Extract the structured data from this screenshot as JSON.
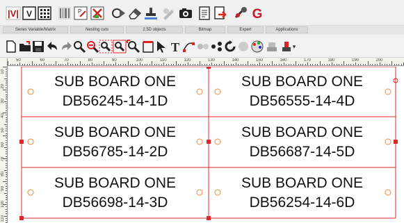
{
  "ribbon": {
    "icons": [
      {
        "name": "series-variable-icon",
        "glyph": "|V|"
      },
      {
        "name": "variable-icon",
        "glyph": "V"
      },
      {
        "name": "matrix-icon",
        "glyph": "grid"
      },
      {
        "name": "barcode-icon",
        "glyph": "bars"
      },
      {
        "name": "nesting-icon",
        "glyph": "nest"
      },
      {
        "name": "nesting-cuts-icon",
        "glyph": "cuts"
      },
      {
        "name": "shapes-icon",
        "glyph": "shapes"
      },
      {
        "name": "eraser-icon",
        "glyph": "eraser"
      },
      {
        "name": "stamp-icon",
        "glyph": "stamp"
      },
      {
        "name": "bitmap-pen-icon",
        "glyph": "pen"
      },
      {
        "name": "camera-icon",
        "glyph": "camera"
      },
      {
        "name": "document-icon",
        "glyph": "doc"
      },
      {
        "name": "export-icon",
        "glyph": "export"
      },
      {
        "name": "tools-icon",
        "glyph": "tools"
      },
      {
        "name": "app-logo-icon",
        "glyph": "G"
      }
    ],
    "groups": [
      {
        "name": "group-series-variable-matrix",
        "label": "Series Variable/Matrix"
      },
      {
        "name": "group-nesting-cuts",
        "label": "Nesting cuts"
      },
      {
        "name": "group-2-5d-objects",
        "label": "2.5D objects"
      },
      {
        "name": "group-bitmap",
        "label": "Bitmap"
      },
      {
        "name": "group-expert",
        "label": "Expert"
      },
      {
        "name": "group-applications",
        "label": "Applications"
      }
    ]
  },
  "toolbar": {
    "icons": [
      "new-document-icon",
      "open-folder-icon",
      "save-icon",
      "undo-icon",
      "redo-icon",
      "zoom-in-icon",
      "zoom-out-icon",
      "zoom-window-icon",
      "zoom-all-icon",
      "zoom-fit-icon",
      "page-frame-icon",
      "select-arrow-icon",
      "text-tool-icon",
      "node-edit-icon",
      "distribute-icon",
      "connect-icon",
      "rotate-icon",
      "color-icon",
      "palette-icon",
      "machine-icon",
      "laser-icon",
      "overflow-icon"
    ],
    "overflow": "▾"
  },
  "rulers": {
    "top_labels": [
      "50",
      "60",
      "70",
      "80",
      "90",
      "100",
      "110",
      "120",
      "130",
      "140",
      "150",
      "160",
      "170",
      "180",
      "190",
      "200"
    ],
    "left_labels": [
      "10",
      "20",
      "30",
      "40",
      "50",
      "60",
      "70",
      "80",
      "90",
      "100",
      "110"
    ]
  },
  "canvas": {
    "accent_color": "#e0282c",
    "cells": [
      {
        "line1": "SUB BOARD ONE",
        "line2": "DB56245-14-1D"
      },
      {
        "line1": "SUB BOARD ONE",
        "line2": "DB56555-14-4D"
      },
      {
        "line1": "SUB BOARD ONE",
        "line2": "DB56785-14-2D"
      },
      {
        "line1": "SUB BOARD ONE",
        "line2": "DB56687-14-5D"
      },
      {
        "line1": "SUB BOARD ONE",
        "line2": "DB56698-14-3D"
      },
      {
        "line1": "SUB BOARD ONE",
        "line2": "DB56254-14-6D"
      }
    ]
  }
}
